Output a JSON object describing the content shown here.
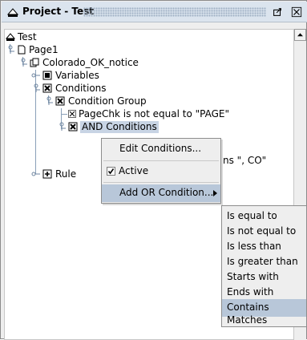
{
  "window": {
    "title": "Project - Test"
  },
  "tree": {
    "root": "Test",
    "page": "Page1",
    "notice": "Colorado_OK_notice",
    "variables": "Variables",
    "conditions": "Conditions",
    "condition_group": "Condition Group",
    "pagechk": "PageChk is not equal to \"PAGE\"",
    "and_conditions": "AND Conditions",
    "partial_contains": "ns \", CO\"",
    "rules_partial": "Rule"
  },
  "context_menu": {
    "edit": "Edit Conditions...",
    "active": "Active",
    "active_checked": true,
    "add_or": "Add OR Condition...",
    "submenu": [
      "Is equal to",
      "Is not equal to",
      "Is less than",
      "Is greater than",
      "Starts with",
      "Ends with",
      "Contains",
      "Matches"
    ],
    "submenu_highlighted": "Contains"
  },
  "colors": {
    "titlebar": "#dbe4ee",
    "selection": "#b8c7d9",
    "tree_line": "#8aa0b8"
  }
}
